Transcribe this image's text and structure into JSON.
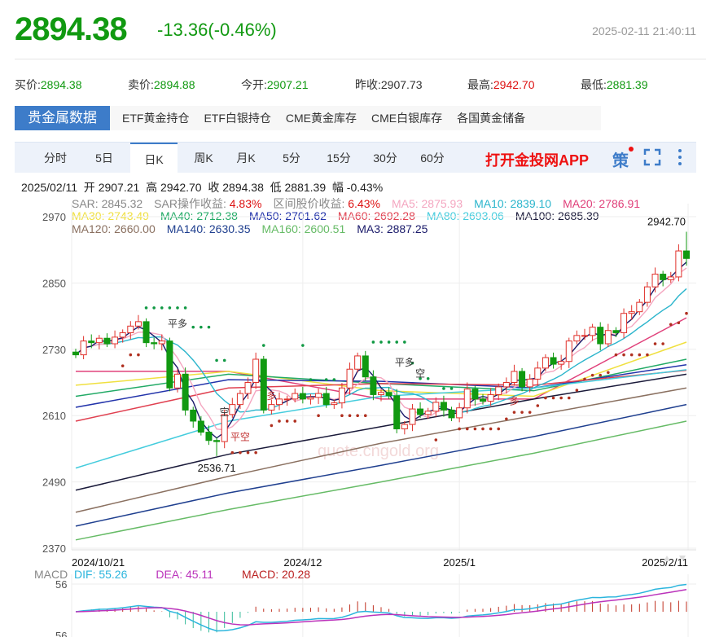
{
  "header": {
    "price": "2894.38",
    "change": "-13.36(-0.46%)",
    "timestamp": "2025-02-11 21:40:11"
  },
  "quote": [
    {
      "label": "买价:",
      "value": "2894.38",
      "color": "green"
    },
    {
      "label": "卖价:",
      "value": "2894.88",
      "color": "green"
    },
    {
      "label": "今开:",
      "value": "2907.21",
      "color": "green"
    },
    {
      "label": "昨收:",
      "value": "2907.73",
      "color": "black"
    },
    {
      "label": "最高:",
      "value": "2942.70",
      "color": "red"
    },
    {
      "label": "最低:",
      "value": "2881.39",
      "color": "green"
    }
  ],
  "data_tabs": [
    "贵金属数据",
    "ETF黄金持仓",
    "ETF白银持仓",
    "CME黄金库存",
    "CME白银库存",
    "各国黄金储备"
  ],
  "period_tabs": [
    "分时",
    "5日",
    "日K",
    "周K",
    "月K",
    "5分",
    "15分",
    "30分",
    "60分"
  ],
  "active_period": "日K",
  "app_link": "打开金投网APP",
  "strategy_label": "策",
  "ohlc_line": "2025/02/11  开 2907.21  高 2942.70  收 2894.38  低 2881.39  幅 -0.43%",
  "legend": [
    [
      {
        "t": "SAR: 2845.32",
        "c": "#888"
      },
      {
        "t": "SAR操作收益: ",
        "c": "#888",
        "v": "4.83%",
        "vc": "#dd1111"
      },
      {
        "t": "区间股价收益: ",
        "c": "#888",
        "v": "6.43%",
        "vc": "#dd1111"
      },
      {
        "t": "MA5: 2875.93",
        "c": "#f4a6c0"
      },
      {
        "t": "MA10: 2839.10",
        "c": "#2bb5cc"
      },
      {
        "t": "MA20: 2786.91",
        "c": "#e0407a"
      }
    ],
    [
      {
        "t": "MA30: 2743.49",
        "c": "#f0e040"
      },
      {
        "t": "MA40: 2712.38",
        "c": "#22aa66"
      },
      {
        "t": "MA50: 2701.62",
        "c": "#2233aa"
      },
      {
        "t": "MA60: 2692.28",
        "c": "#e04050"
      },
      {
        "t": "MA80: 2693.06",
        "c": "#44ccdd"
      },
      {
        "t": "MA100: 2685.39",
        "c": "#1a1a3a"
      }
    ],
    [
      {
        "t": "MA120: 2660.00",
        "c": "#8a7060"
      },
      {
        "t": "MA140: 2630.35",
        "c": "#1f3f8f"
      },
      {
        "t": "MA160: 2600.51",
        "c": "#66bb66"
      },
      {
        "t": "MA3: 2887.25",
        "c": "#1a1a6a"
      }
    ]
  ],
  "watermark": "quote.cngold.org",
  "macd_legend": {
    "label": "MACD",
    "dif": "DIF: 55.26",
    "dea": "DEA: 45.11",
    "macd": "MACD: 20.28"
  },
  "chart_data": {
    "type": "candlestick",
    "ylim": [
      2370,
      2970
    ],
    "yticks": [
      "2970",
      "2850",
      "2730",
      "2610",
      "2490",
      "2370"
    ],
    "xticks": [
      {
        "label": "2024/10/21",
        "i": 0
      },
      {
        "label": "2024/12",
        "i": 29
      },
      {
        "label": "2025/1",
        "i": 49
      },
      {
        "label": "2025/2/11",
        "i": 76
      }
    ],
    "first_open": 2725,
    "closes": [
      2720,
      2745,
      2742,
      2750,
      2740,
      2752,
      2760,
      2772,
      2780,
      2742,
      2740,
      2745,
      2660,
      2685,
      2620,
      2600,
      2580,
      2565,
      2563,
      2612,
      2630,
      2650,
      2670,
      2712,
      2620,
      2630,
      2640,
      2640,
      2650,
      2640,
      2643,
      2650,
      2630,
      2633,
      2660,
      2694,
      2718,
      2680,
      2648,
      2652,
      2646,
      2586,
      2594,
      2622,
      2612,
      2618,
      2634,
      2620,
      2606,
      2624,
      2658,
      2640,
      2636,
      2648,
      2662,
      2670,
      2690,
      2662,
      2676,
      2696,
      2715,
      2703,
      2708,
      2745,
      2755,
      2755,
      2770,
      2740,
      2764,
      2760,
      2795,
      2798,
      2815,
      2843,
      2866,
      2856,
      2861,
      2908,
      2894.38
    ],
    "annotations": {
      "high_label": "2942.70",
      "low_label": "2536.71",
      "high": 2942.7,
      "low": 2536.71,
      "signals": [
        "平多",
        "空",
        "平空",
        "多",
        "平多",
        "空",
        "多"
      ]
    },
    "long_ma": [
      {
        "name": "MA20",
        "color": "#e0407a",
        "values": [
          2690,
          2690,
          2640,
          2640,
          2787
        ]
      },
      {
        "name": "MA30",
        "color": "#f0e040",
        "values": [
          2665,
          2690,
          2655,
          2645,
          2743
        ]
      },
      {
        "name": "MA40",
        "color": "#22aa66",
        "values": [
          2645,
          2685,
          2668,
          2655,
          2712
        ]
      },
      {
        "name": "MA50",
        "color": "#2233aa",
        "values": [
          2625,
          2675,
          2672,
          2660,
          2702
        ]
      },
      {
        "name": "MA60",
        "color": "#e04050",
        "values": [
          2600,
          2660,
          2668,
          2665,
          2692
        ]
      },
      {
        "name": "MA80",
        "color": "#44ccdd",
        "values": [
          2515,
          2600,
          2645,
          2660,
          2693
        ]
      },
      {
        "name": "MA100",
        "color": "#1a1a3a",
        "values": [
          2475,
          2540,
          2590,
          2640,
          2685
        ]
      },
      {
        "name": "MA120",
        "color": "#8a7060",
        "values": [
          2435,
          2500,
          2560,
          2610,
          2660
        ]
      },
      {
        "name": "MA140",
        "color": "#1f3f8f",
        "values": [
          2410,
          2470,
          2520,
          2572,
          2630
        ]
      },
      {
        "name": "MA160",
        "color": "#66bb66",
        "values": [
          2385,
          2440,
          2490,
          2542,
          2600
        ]
      }
    ],
    "macd_range": [
      -56,
      56
    ],
    "macd_ticks": [
      "56",
      "56"
    ]
  }
}
